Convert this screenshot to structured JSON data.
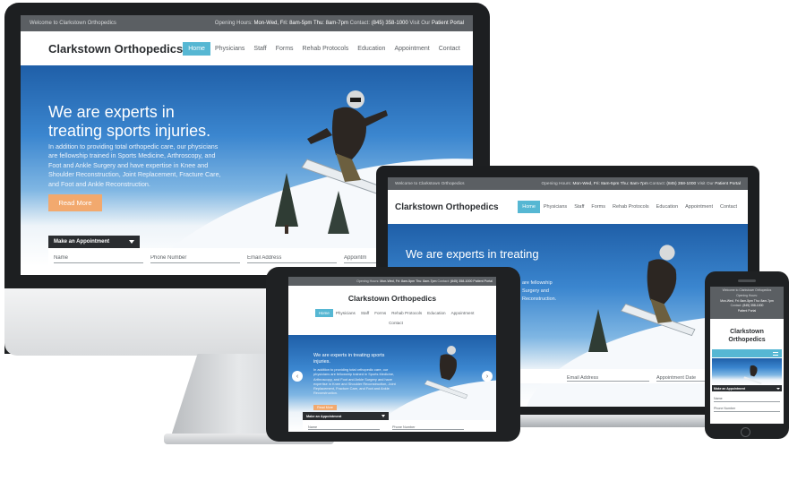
{
  "site": {
    "welcome": "Welcome to Clarkstown Orthopedics",
    "hours_label": "Opening Hours:",
    "hours_value": "Mon-Wed, Fri: 8am-5pm  Thu: 8am-7pm",
    "contact_label": "Contact:",
    "contact_value": "(845) 358-1000",
    "portal_label": "Visit Our",
    "portal_link": "Patient Portal",
    "brand": "Clarkstown Orthopedics",
    "nav": [
      "Home",
      "Physicians",
      "Staff",
      "Forms",
      "Rehab Protocols",
      "Education",
      "Appointment",
      "Contact"
    ],
    "headline": "We are experts in treating sports injuries.",
    "headline_line1": "We are experts in",
    "headline_line2": "treating sports injuries.",
    "laptop_headline": "We are experts in treating",
    "body": "In addition to providing total orthopedic care, our physicians are fellowship trained in Sports Medicine, Arthroscopy, and Foot and Ankle Surgery and have expertise in Knee and Shoulder Reconstruction, Joint Replacement, Fracture Care, and Foot and Ankle Reconstruction.",
    "laptop_body_frag1": "are fellowship",
    "laptop_body_frag2": "Surgery and",
    "laptop_body_frag3": "Reconstruction.",
    "read_more": "Read More",
    "appointment_tab": "Make an Appointment",
    "fields": {
      "name": "Name",
      "phone": "Phone Number",
      "email": "Email Address",
      "date": "Appointment Date",
      "date_short": "Appointm"
    }
  },
  "colors": {
    "accent": "#56b7d3",
    "button": "#f2a96e",
    "topbar": "#5b5f63",
    "appointment": "#2a2d30"
  }
}
